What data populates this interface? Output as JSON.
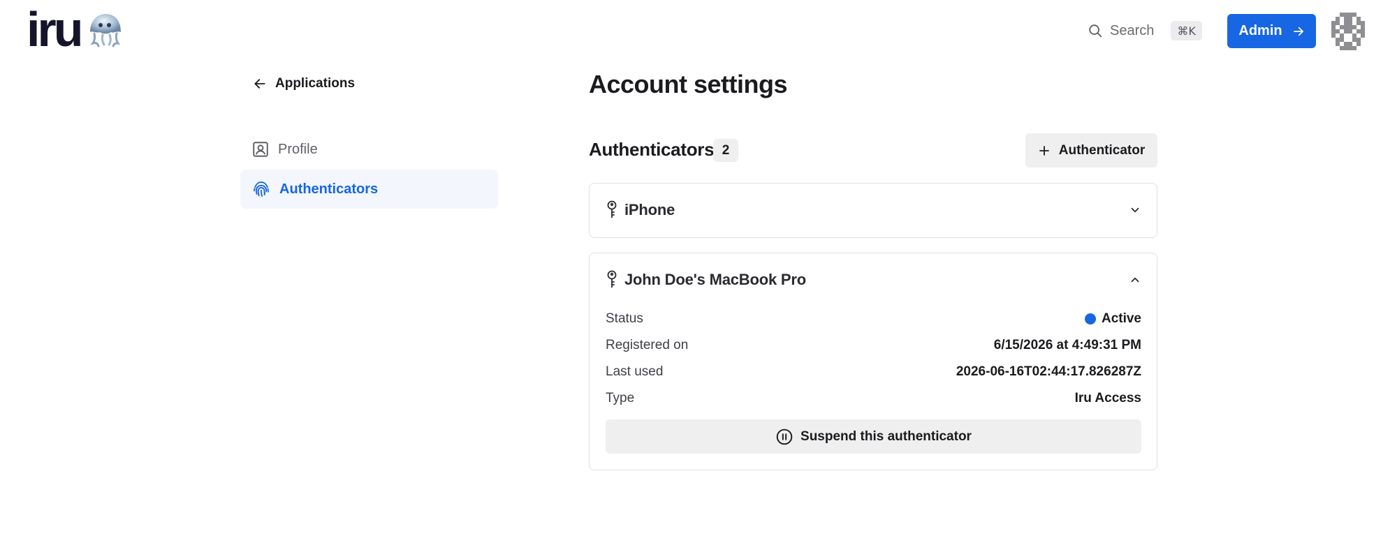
{
  "app": {
    "logo_text": "iru"
  },
  "header": {
    "search_label": "Search",
    "search_shortcut": "⌘K",
    "admin_label": "Admin"
  },
  "sidebar": {
    "back_label": "Applications",
    "items": [
      {
        "label": "Profile",
        "icon": "profile-icon",
        "active": false
      },
      {
        "label": "Authenticators",
        "icon": "fingerprint-icon",
        "active": true
      }
    ]
  },
  "main": {
    "title": "Account settings",
    "section": {
      "title": "Authenticators",
      "count": "2",
      "add_label": "Authenticator"
    },
    "authenticators": [
      {
        "name": "iPhone",
        "expanded": false
      },
      {
        "name": "John Doe's MacBook Pro",
        "expanded": true,
        "details": [
          {
            "label": "Status",
            "value": "Active"
          },
          {
            "label": "Registered on",
            "value": "6/15/2026 at 4:49:31 PM"
          },
          {
            "label": "Last used",
            "value": "2026-06-16T02:44:17.826287Z"
          },
          {
            "label": "Type",
            "value": "Iru Access"
          }
        ],
        "suspend_label": "Suspend this authenticator"
      }
    ]
  },
  "colors": {
    "accent": "#1766e3",
    "active_nav_bg": "#f3f6fc",
    "button_gray": "#efefef",
    "border": "#e0e0e3"
  }
}
